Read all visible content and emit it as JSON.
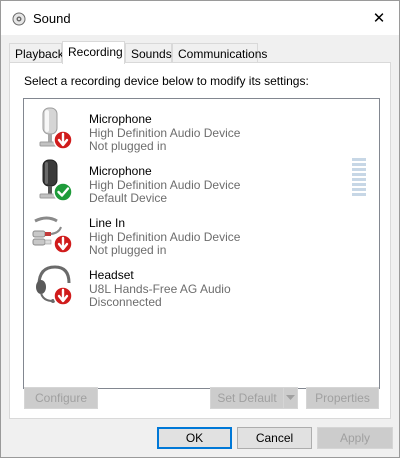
{
  "window": {
    "title": "Sound",
    "close_glyph": "✕"
  },
  "tabs": [
    {
      "label": "Playback",
      "active": false
    },
    {
      "label": "Recording",
      "active": true
    },
    {
      "label": "Sounds",
      "active": false
    },
    {
      "label": "Communications",
      "active": false
    }
  ],
  "panel": {
    "instructions": "Select a recording device below to modify its settings:"
  },
  "devices": [
    {
      "name": "Microphone",
      "description": "High Definition Audio Device",
      "status": "Not plugged in",
      "icon": "microphone-icon",
      "badge": "red-down-arrow-badge"
    },
    {
      "name": "Microphone",
      "description": "High Definition Audio Device",
      "status": "Default Device",
      "icon": "microphone-icon",
      "badge": "green-check-badge",
      "level_fraction": 0
    },
    {
      "name": "Line In",
      "description": "High Definition Audio Device",
      "status": "Not plugged in",
      "icon": "line-in-cable-icon",
      "badge": "red-down-arrow-badge"
    },
    {
      "name": "Headset",
      "description": "U8L Hands-Free AG Audio",
      "status": "Disconnected",
      "icon": "headset-icon",
      "badge": "red-down-arrow-badge"
    }
  ],
  "buttons": {
    "configure": "Configure",
    "set_default": "Set Default",
    "properties": "Properties",
    "ok": "OK",
    "cancel": "Cancel",
    "apply": "Apply"
  },
  "colors": {
    "accent": "#0078d7",
    "error_badge": "#d01c1c",
    "ok_badge": "#1e9b3a",
    "secondary_text": "#6d6d6d"
  }
}
